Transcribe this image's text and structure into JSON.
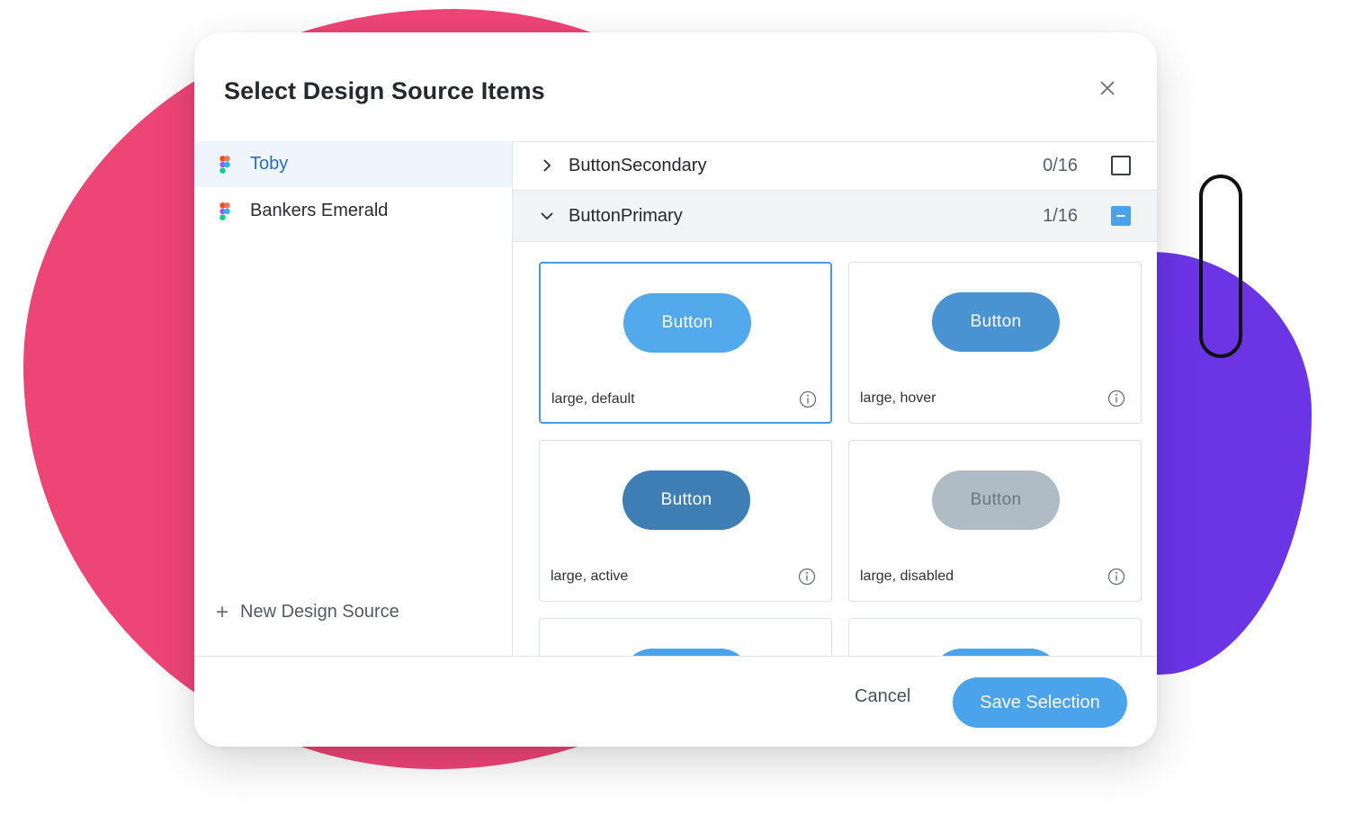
{
  "dialog": {
    "title": "Select Design Source Items"
  },
  "sidebar": {
    "items": [
      {
        "label": "Toby",
        "icon": "figma-icon",
        "active": true
      },
      {
        "label": "Bankers Emerald",
        "icon": "figma-icon",
        "active": false
      }
    ],
    "new_source_label": "New Design Source"
  },
  "groups": [
    {
      "name": "ButtonSecondary",
      "count": "0/16",
      "expanded": false,
      "checkbox": "unchecked"
    },
    {
      "name": "ButtonPrimary",
      "count": "1/16",
      "expanded": true,
      "checkbox": "partial"
    }
  ],
  "items": [
    {
      "button_text": "Button",
      "label": "large, default",
      "selected": true,
      "button_color": "#52a9ec"
    },
    {
      "button_text": "Button",
      "label": "large, hover",
      "selected": false,
      "button_color": "#4a93d3"
    },
    {
      "button_text": "Button",
      "label": "large, active",
      "selected": false,
      "button_color": "#3f7db5"
    },
    {
      "button_text": "Button",
      "label": "large, disabled",
      "selected": false,
      "button_color": "#b0bcc5"
    },
    {
      "button_text": "",
      "label": "",
      "selected": false,
      "button_color": "#4ba3ec"
    },
    {
      "button_text": "",
      "label": "",
      "selected": false,
      "button_color": "#4ba3ec"
    }
  ],
  "footer": {
    "cancel_label": "Cancel",
    "save_label": "Save Selection"
  },
  "colors": {
    "accent": "#4ba3ec",
    "pink_blob": "#ee4577",
    "purple_blob": "#6b35e6"
  }
}
